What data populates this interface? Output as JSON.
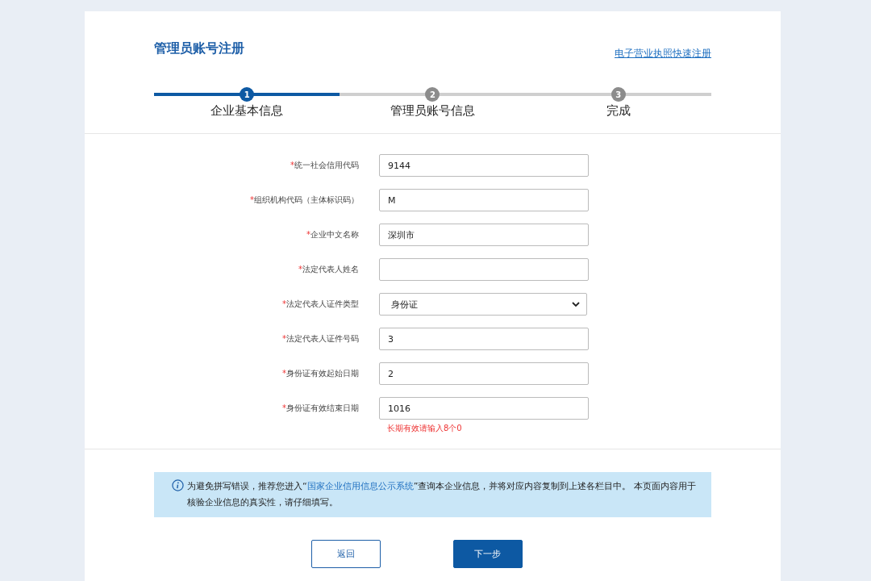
{
  "header": {
    "title": "管理员账号注册",
    "quick_link": "电子营业执照快速注册"
  },
  "steps": [
    {
      "number": "1",
      "label": "企业基本信息",
      "selected": true
    },
    {
      "number": "2",
      "label": "管理员账号信息",
      "selected": false
    },
    {
      "number": "3",
      "label": "完成",
      "selected": false
    }
  ],
  "fields": [
    {
      "kind": "text",
      "required_mark": "*",
      "label": "统一社会信用代码",
      "value": "9144"
    },
    {
      "kind": "text",
      "required_mark": "*",
      "label": "组织机构代码（主体标识码）",
      "value": "M"
    },
    {
      "kind": "text",
      "required_mark": "*",
      "label": "企业中文名称",
      "value": "深圳市"
    },
    {
      "kind": "text",
      "required_mark": "*",
      "label": "法定代表人姓名"
    },
    {
      "kind": "select",
      "required_mark": "*",
      "label": "法定代表人证件类型",
      "value": "身份证"
    },
    {
      "kind": "text",
      "required_mark": "*",
      "label": "法定代表人证件号码",
      "value": "3"
    },
    {
      "kind": "text",
      "required_mark": "*",
      "label": "身份证有效起始日期",
      "value": "2"
    },
    {
      "kind": "text",
      "required_mark": "*",
      "label": "身份证有效结束日期",
      "value": "1016",
      "hint": "长期有效请输入8个0"
    }
  ],
  "notice": {
    "before": "为避免拼写错误，推荐您进入“",
    "link": "国家企业信用信息公示系统",
    "after": "”查询本企业信息，并将对应内容复制到上述各栏目中。 本页面内容用于核验企业信息的真实性，请仔细填写。"
  },
  "buttons": {
    "back": "返回",
    "next": "下一步"
  }
}
